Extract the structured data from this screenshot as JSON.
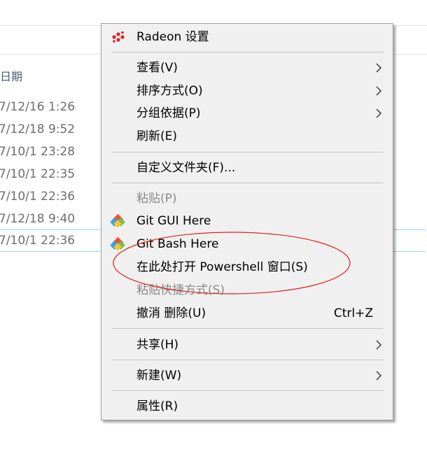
{
  "explorer": {
    "column_header": "日期",
    "rows": [
      "7/12/16 1:26",
      "7/12/18 9:52",
      "7/10/1 23:28",
      "7/10/1 22:35",
      "7/10/1 22:36",
      "7/12/18 9:40",
      "7/10/1 22:36"
    ]
  },
  "menu": {
    "radeon": "Radeon 设置",
    "view": "查看(V)",
    "sort": "排序方式(O)",
    "group": "分组依据(P)",
    "refresh": "刷新(E)",
    "customize": "自定义文件夹(F)...",
    "paste": "粘贴(P)",
    "git_gui": "Git GUI Here",
    "git_bash": "Git Bash Here",
    "powershell": "在此处打开 Powershell 窗口(S)",
    "paste_shortcut": "粘贴快捷方式(S)",
    "undo": "撤消 删除(U)",
    "undo_shortcut": "Ctrl+Z",
    "share": "共享(H)",
    "new": "新建(W)",
    "properties": "属性(R)"
  },
  "colors": {
    "menu_bg": "#f0f0f0",
    "highlight_ellipse": "#e0211d",
    "radeon_red": "#d9262b",
    "git_orange": "#f05133",
    "git_green": "#7ac143",
    "git_blue": "#3aa0e0"
  }
}
